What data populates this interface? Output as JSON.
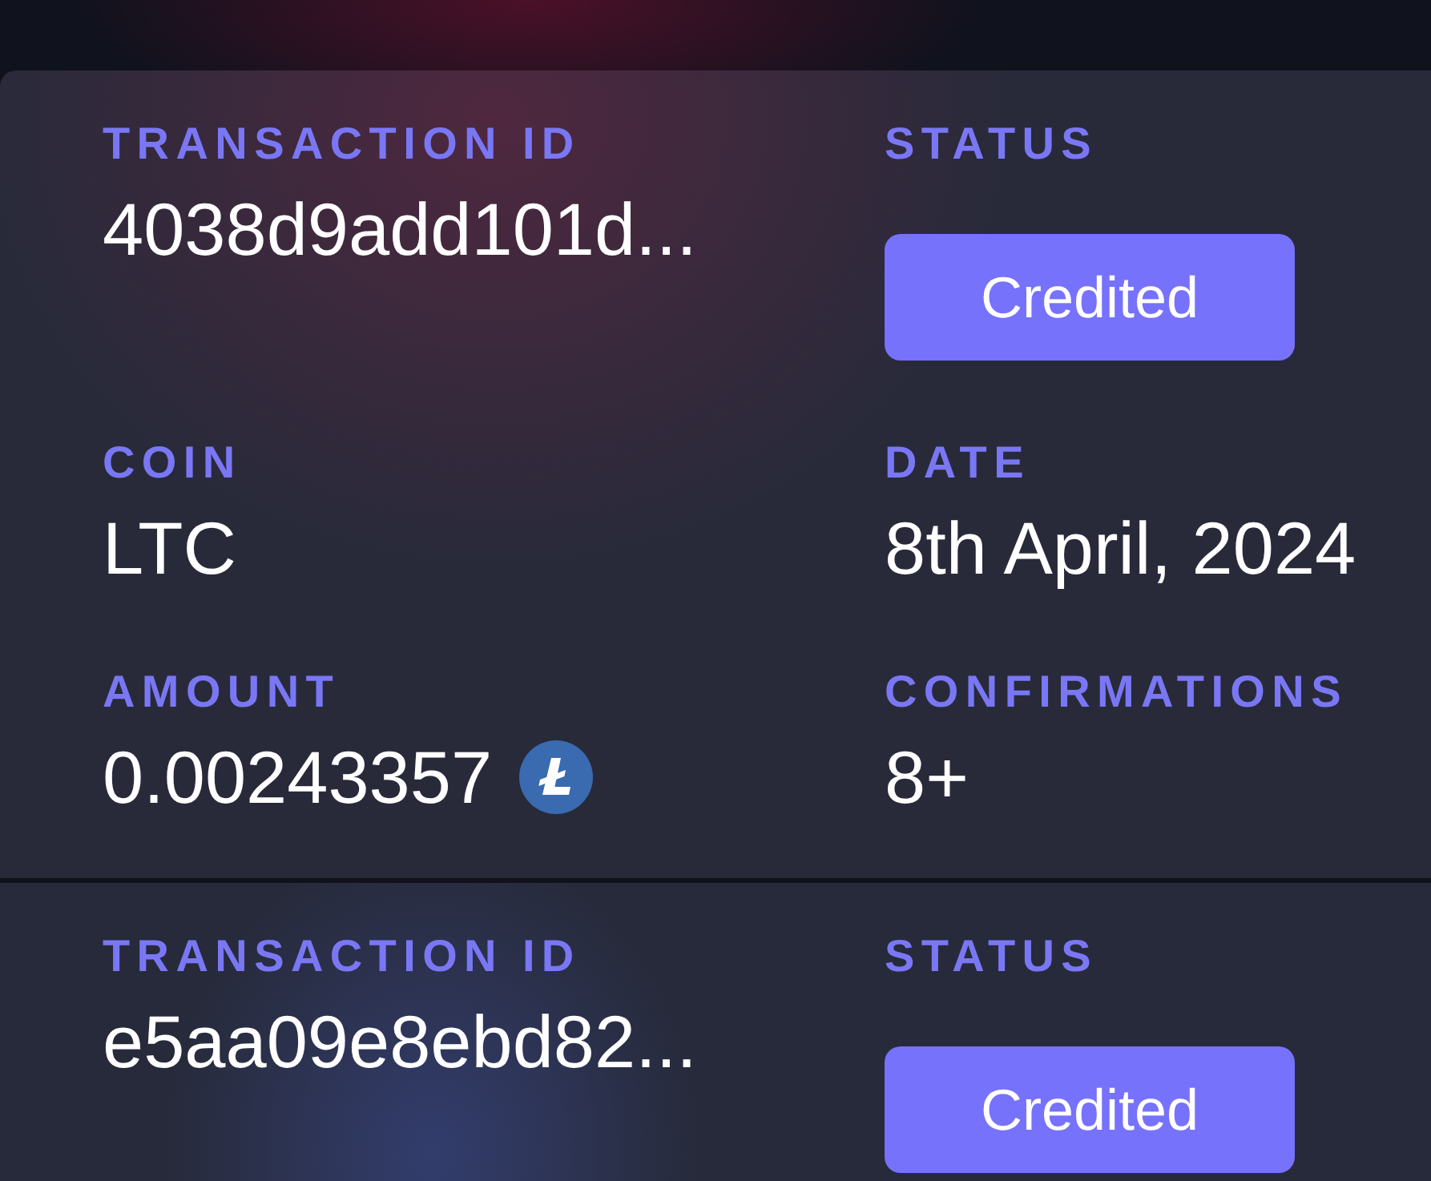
{
  "transactions": [
    {
      "fields": [
        {
          "kind": "text",
          "label": "TRANSACTION ID",
          "value": "4038d9add101d..."
        },
        {
          "kind": "status",
          "label": "STATUS",
          "value": "Credited"
        },
        {
          "kind": "text",
          "label": "COIN",
          "value": "LTC"
        },
        {
          "kind": "text",
          "label": "DATE",
          "value": "8th April, 2024"
        },
        {
          "kind": "amount",
          "label": "AMOUNT",
          "value": "0.00243357"
        },
        {
          "kind": "text",
          "label": "CONFIRMATIONS",
          "value": "8+"
        }
      ]
    },
    {
      "fields": [
        {
          "kind": "text",
          "label": "TRANSACTION ID",
          "value": "e5aa09e8ebd82..."
        },
        {
          "kind": "status",
          "label": "STATUS",
          "value": "Credited"
        }
      ]
    }
  ]
}
